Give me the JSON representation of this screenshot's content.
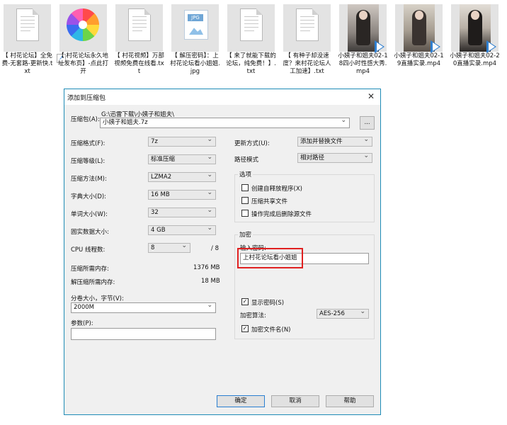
{
  "files": [
    {
      "kind": "txt",
      "name": "【 村花论坛】全免费-无套路-更新快.txt"
    },
    {
      "kind": "shortcut",
      "name": "【 村花论坛永久地址发布页】-点此打开"
    },
    {
      "kind": "txt",
      "name": "【 村花视频】万部视频免费在线看.txt"
    },
    {
      "kind": "jpg",
      "name": "【 解压密码】：上村花论坛看小姐姐.jpg",
      "badge": "JPG"
    },
    {
      "kind": "txt",
      "name": "【 来了就能下载的论坛，纯免费！】.txt"
    },
    {
      "kind": "txt",
      "name": "【 有种子却没速度？来村花论坛人工加速】.txt"
    },
    {
      "kind": "mp4",
      "name": "小姨子和姐夫02-18四小时性感大秀.mp4"
    },
    {
      "kind": "mp4",
      "name": "小姨子和姐夫02-19直播实录.mp4"
    },
    {
      "kind": "mp4",
      "name": "小姨子和姐夫02-20直播实录.mp4"
    }
  ],
  "dialog": {
    "title": "添加到压缩包",
    "close_glyph": "✕",
    "archive_label": "压缩包(A):",
    "archive_dir": "G:\\迅雷下载\\小姨子和姐夫\\",
    "archive_name": "小姨子和姐夫.7z",
    "browse_label": "...",
    "left": {
      "format": {
        "label": "压缩格式(F):",
        "value": "7z"
      },
      "level": {
        "label": "压缩等级(L):",
        "value": "标准压缩"
      },
      "method": {
        "label": "压缩方法(M):",
        "value": "LZMA2"
      },
      "dict": {
        "label": "字典大小(D):",
        "value": "16 MB"
      },
      "word": {
        "label": "单词大小(W):",
        "value": "32"
      },
      "solid": {
        "label": "固实数据大小:",
        "value": "4 GB"
      },
      "threads": {
        "label": "CPU 线程数:",
        "value": "8",
        "max": "/ 8"
      },
      "mem_compress": {
        "label": "压缩所需内存:",
        "value": "1376 MB"
      },
      "mem_decompress": {
        "label": "解压缩所需内存:",
        "value": "18 MB"
      },
      "split_label": "分卷大小，字节(V):",
      "split_value": "2000M",
      "params_label": "参数(P):",
      "params_value": ""
    },
    "right": {
      "update": {
        "label": "更新方式(U):",
        "value": "添加并替换文件"
      },
      "path": {
        "label": "路径模式",
        "value": "相对路径"
      },
      "options": {
        "title": "选项",
        "sfx": "创建自释放程序(X)",
        "shared": "压缩共享文件",
        "delete": "操作完成后删除源文件"
      },
      "encryption": {
        "title": "加密",
        "pwd_label": "输入密码:",
        "pwd_value": "上村花论坛看小姐姐",
        "show_pwd": "显示密码(S)",
        "show_pwd_checked": true,
        "method_label": "加密算法:",
        "method_value": "AES-256",
        "encrypt_names": "加密文件名(N)",
        "encrypt_names_checked": true
      }
    },
    "buttons": {
      "ok": "确定",
      "cancel": "取消",
      "help": "帮助"
    }
  },
  "colors": {
    "accent": "#1e8bb6",
    "highlight": "#e02020"
  }
}
